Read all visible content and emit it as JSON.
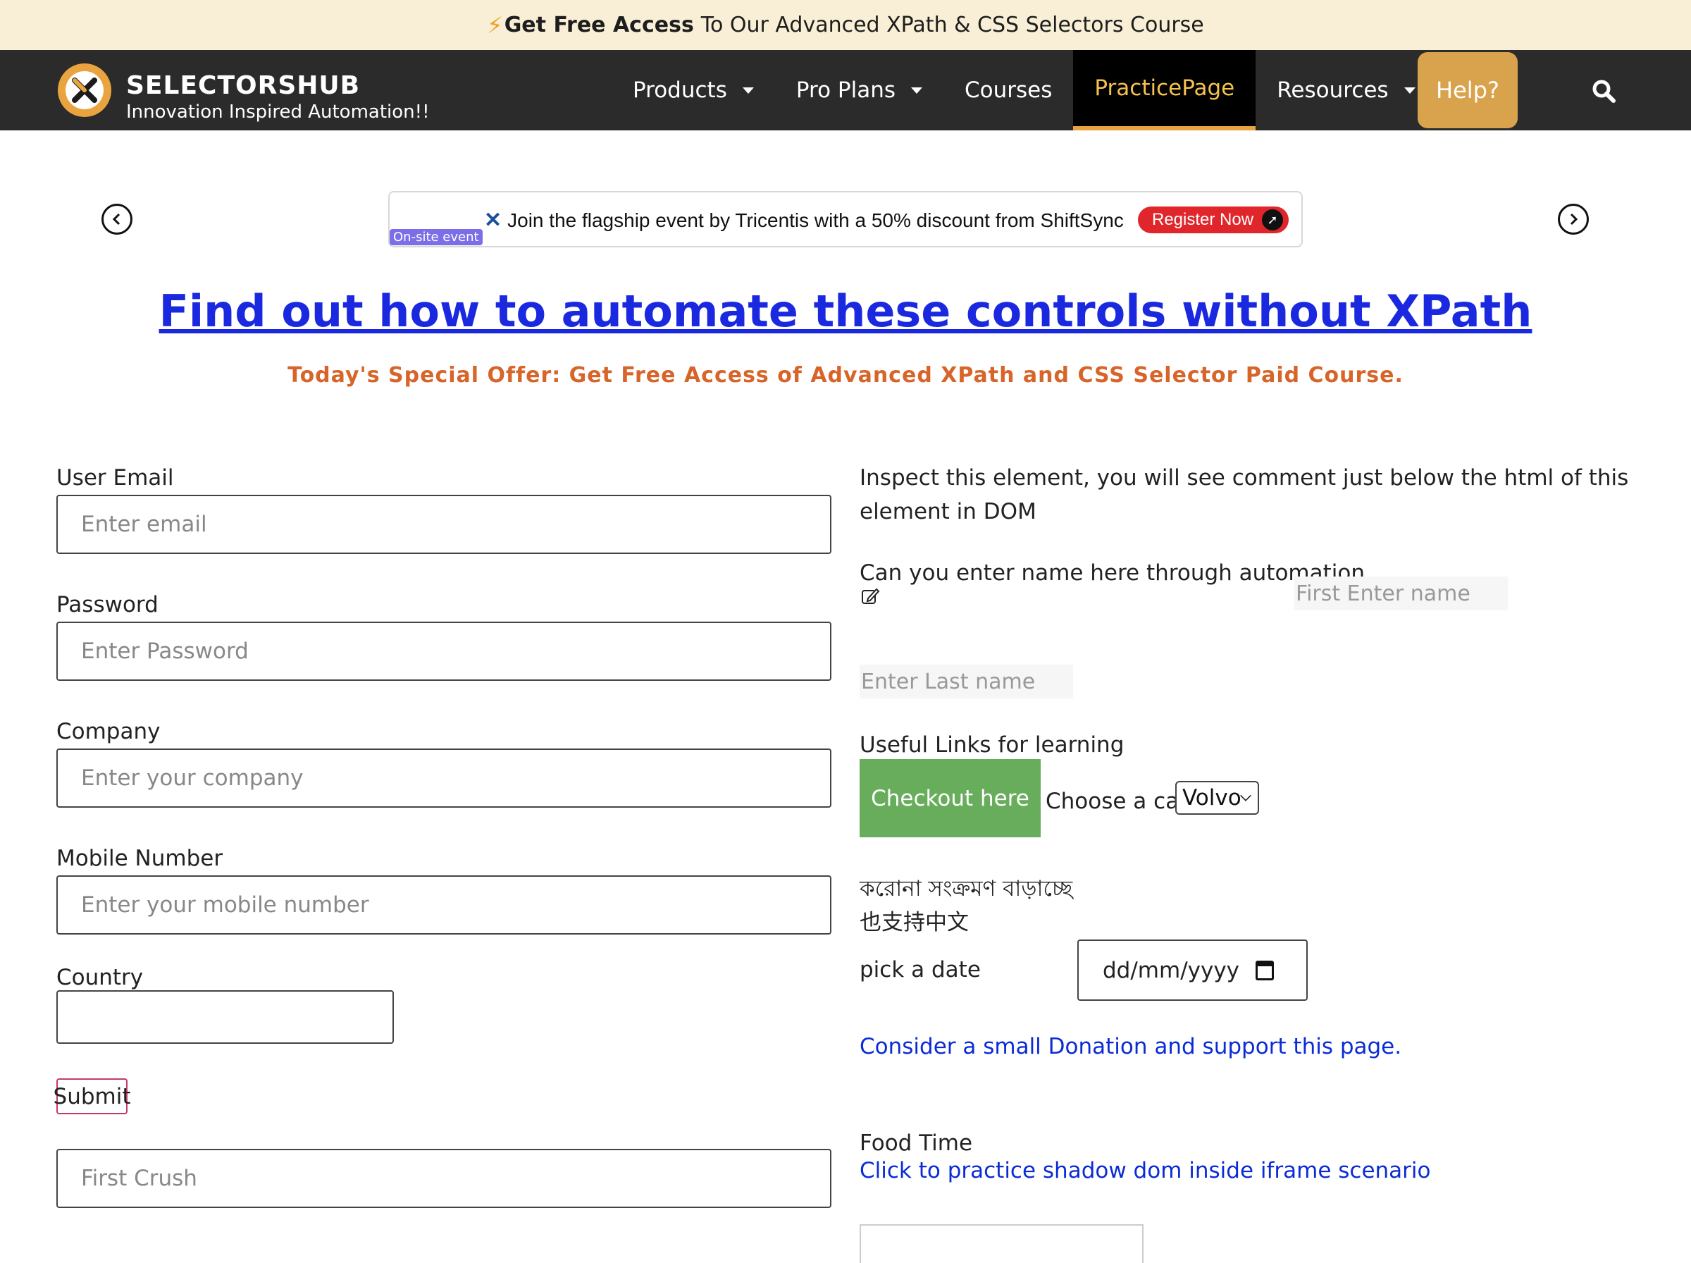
{
  "promo": {
    "bolt": "⚡",
    "strong": "Get Free Access",
    "rest": "To Our Advanced XPath & CSS Selectors Course"
  },
  "header": {
    "brand": "SELECTORSHUB",
    "tagline": "Innovation Inspired Automation!!",
    "nav": {
      "products": "Products",
      "pro_plans": "Pro Plans",
      "courses": "Courses",
      "practice": "PracticePage",
      "resources": "Resources",
      "help": "Help?"
    },
    "accent": "#e9a43f"
  },
  "ad": {
    "tag": "On-site event",
    "text": "Join the flagship event by Tricentis with a 50% discount from ShiftSync",
    "cta": "Register Now"
  },
  "headline": "Find out how to automate these controls without XPath",
  "subline": "Today's Special Offer: Get Free Access of Advanced XPath and CSS Selector Paid Course.",
  "form": {
    "email_label": "User Email",
    "email_placeholder": "Enter email",
    "password_label": "Password",
    "password_placeholder": "Enter Password",
    "company_label": "Company",
    "company_placeholder": "Enter your company",
    "mobile_label": "Mobile Number",
    "mobile_placeholder": "Enter your mobile number",
    "country_label": "Country",
    "submit": "Submit",
    "crush_placeholder": "First Crush"
  },
  "right": {
    "inspect_text": "Inspect this element, you will see comment just below the html of this element in DOM",
    "name_prompt": "Can you enter name here through automation",
    "first_name_placeholder": "First Enter name",
    "last_name_placeholder": "Enter Last name",
    "useful_links": "Useful Links for learning",
    "checkout": "Checkout here",
    "car_label": "Choose a car:",
    "car_selected": "Volvo",
    "bengali": "করোনা সংক্রমণ বাড়াচ্ছে",
    "chinese": "也支持中文",
    "date_label": "pick a date",
    "date_placeholder": "dd/mm/yyyy",
    "donation": "Consider a small Donation and support this page.",
    "food_time": "Food Time",
    "shadow_link": "Click to practice shadow dom inside iframe scenario"
  }
}
